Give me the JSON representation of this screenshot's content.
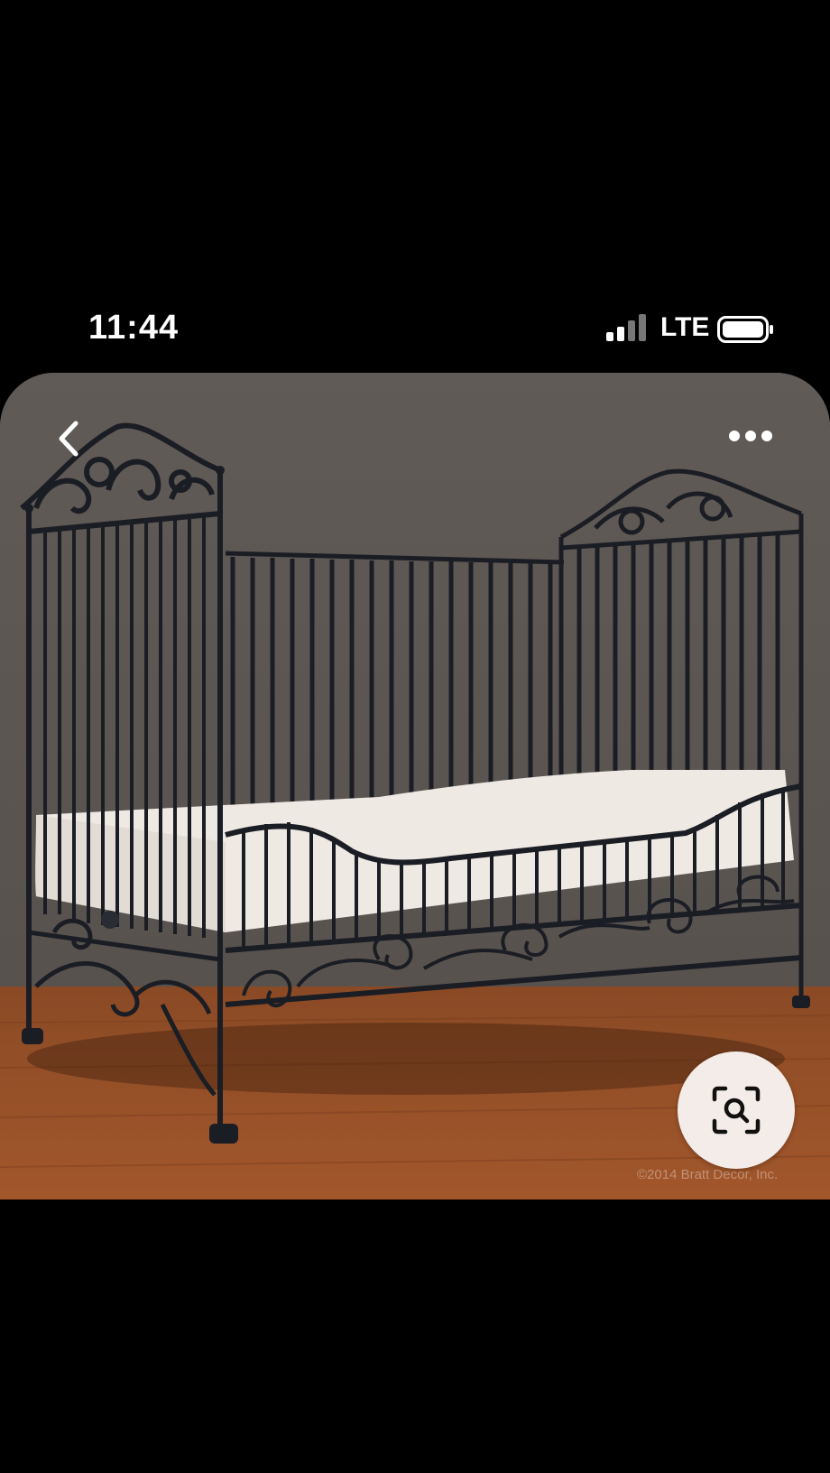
{
  "status_bar": {
    "time": "11:44",
    "carrier": "LTE"
  },
  "image": {
    "watermark": "©2014 Bratt Decor, Inc."
  },
  "icons": {
    "back": "chevron-left-icon",
    "more": "more-horizontal-icon",
    "lens": "visual-search-icon"
  }
}
